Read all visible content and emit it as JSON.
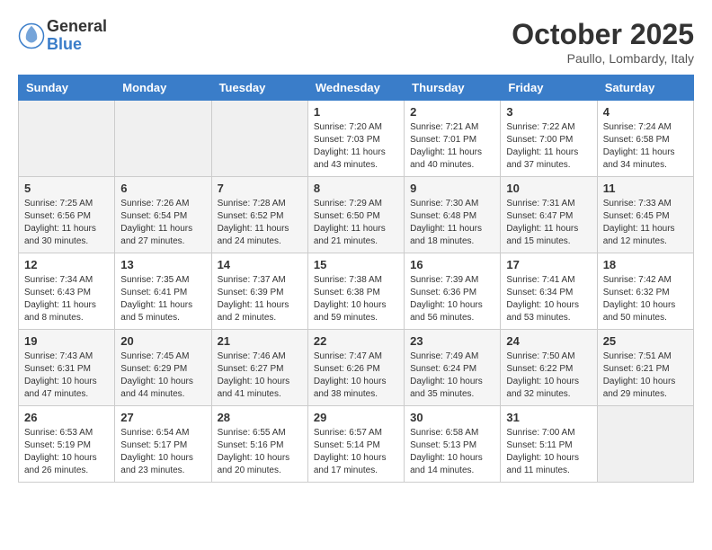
{
  "logo": {
    "general": "General",
    "blue": "Blue"
  },
  "header": {
    "month": "October 2025",
    "location": "Paullo, Lombardy, Italy"
  },
  "weekdays": [
    "Sunday",
    "Monday",
    "Tuesday",
    "Wednesday",
    "Thursday",
    "Friday",
    "Saturday"
  ],
  "weeks": [
    [
      {
        "day": "",
        "info": ""
      },
      {
        "day": "",
        "info": ""
      },
      {
        "day": "",
        "info": ""
      },
      {
        "day": "1",
        "info": "Sunrise: 7:20 AM\nSunset: 7:03 PM\nDaylight: 11 hours\nand 43 minutes."
      },
      {
        "day": "2",
        "info": "Sunrise: 7:21 AM\nSunset: 7:01 PM\nDaylight: 11 hours\nand 40 minutes."
      },
      {
        "day": "3",
        "info": "Sunrise: 7:22 AM\nSunset: 7:00 PM\nDaylight: 11 hours\nand 37 minutes."
      },
      {
        "day": "4",
        "info": "Sunrise: 7:24 AM\nSunset: 6:58 PM\nDaylight: 11 hours\nand 34 minutes."
      }
    ],
    [
      {
        "day": "5",
        "info": "Sunrise: 7:25 AM\nSunset: 6:56 PM\nDaylight: 11 hours\nand 30 minutes."
      },
      {
        "day": "6",
        "info": "Sunrise: 7:26 AM\nSunset: 6:54 PM\nDaylight: 11 hours\nand 27 minutes."
      },
      {
        "day": "7",
        "info": "Sunrise: 7:28 AM\nSunset: 6:52 PM\nDaylight: 11 hours\nand 24 minutes."
      },
      {
        "day": "8",
        "info": "Sunrise: 7:29 AM\nSunset: 6:50 PM\nDaylight: 11 hours\nand 21 minutes."
      },
      {
        "day": "9",
        "info": "Sunrise: 7:30 AM\nSunset: 6:48 PM\nDaylight: 11 hours\nand 18 minutes."
      },
      {
        "day": "10",
        "info": "Sunrise: 7:31 AM\nSunset: 6:47 PM\nDaylight: 11 hours\nand 15 minutes."
      },
      {
        "day": "11",
        "info": "Sunrise: 7:33 AM\nSunset: 6:45 PM\nDaylight: 11 hours\nand 12 minutes."
      }
    ],
    [
      {
        "day": "12",
        "info": "Sunrise: 7:34 AM\nSunset: 6:43 PM\nDaylight: 11 hours\nand 8 minutes."
      },
      {
        "day": "13",
        "info": "Sunrise: 7:35 AM\nSunset: 6:41 PM\nDaylight: 11 hours\nand 5 minutes."
      },
      {
        "day": "14",
        "info": "Sunrise: 7:37 AM\nSunset: 6:39 PM\nDaylight: 11 hours\nand 2 minutes."
      },
      {
        "day": "15",
        "info": "Sunrise: 7:38 AM\nSunset: 6:38 PM\nDaylight: 10 hours\nand 59 minutes."
      },
      {
        "day": "16",
        "info": "Sunrise: 7:39 AM\nSunset: 6:36 PM\nDaylight: 10 hours\nand 56 minutes."
      },
      {
        "day": "17",
        "info": "Sunrise: 7:41 AM\nSunset: 6:34 PM\nDaylight: 10 hours\nand 53 minutes."
      },
      {
        "day": "18",
        "info": "Sunrise: 7:42 AM\nSunset: 6:32 PM\nDaylight: 10 hours\nand 50 minutes."
      }
    ],
    [
      {
        "day": "19",
        "info": "Sunrise: 7:43 AM\nSunset: 6:31 PM\nDaylight: 10 hours\nand 47 minutes."
      },
      {
        "day": "20",
        "info": "Sunrise: 7:45 AM\nSunset: 6:29 PM\nDaylight: 10 hours\nand 44 minutes."
      },
      {
        "day": "21",
        "info": "Sunrise: 7:46 AM\nSunset: 6:27 PM\nDaylight: 10 hours\nand 41 minutes."
      },
      {
        "day": "22",
        "info": "Sunrise: 7:47 AM\nSunset: 6:26 PM\nDaylight: 10 hours\nand 38 minutes."
      },
      {
        "day": "23",
        "info": "Sunrise: 7:49 AM\nSunset: 6:24 PM\nDaylight: 10 hours\nand 35 minutes."
      },
      {
        "day": "24",
        "info": "Sunrise: 7:50 AM\nSunset: 6:22 PM\nDaylight: 10 hours\nand 32 minutes."
      },
      {
        "day": "25",
        "info": "Sunrise: 7:51 AM\nSunset: 6:21 PM\nDaylight: 10 hours\nand 29 minutes."
      }
    ],
    [
      {
        "day": "26",
        "info": "Sunrise: 6:53 AM\nSunset: 5:19 PM\nDaylight: 10 hours\nand 26 minutes."
      },
      {
        "day": "27",
        "info": "Sunrise: 6:54 AM\nSunset: 5:17 PM\nDaylight: 10 hours\nand 23 minutes."
      },
      {
        "day": "28",
        "info": "Sunrise: 6:55 AM\nSunset: 5:16 PM\nDaylight: 10 hours\nand 20 minutes."
      },
      {
        "day": "29",
        "info": "Sunrise: 6:57 AM\nSunset: 5:14 PM\nDaylight: 10 hours\nand 17 minutes."
      },
      {
        "day": "30",
        "info": "Sunrise: 6:58 AM\nSunset: 5:13 PM\nDaylight: 10 hours\nand 14 minutes."
      },
      {
        "day": "31",
        "info": "Sunrise: 7:00 AM\nSunset: 5:11 PM\nDaylight: 10 hours\nand 11 minutes."
      },
      {
        "day": "",
        "info": ""
      }
    ]
  ]
}
